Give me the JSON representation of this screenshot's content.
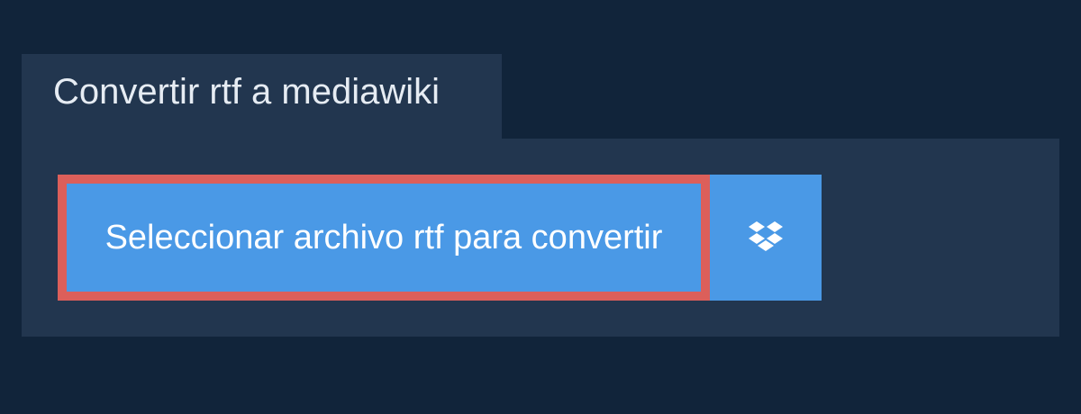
{
  "tab": {
    "title": "Convertir rtf a mediawiki"
  },
  "upload": {
    "select_label": "Seleccionar archivo rtf para convertir",
    "dropbox_icon": "dropbox-icon"
  },
  "colors": {
    "background": "#11243a",
    "panel": "#22364f",
    "button": "#4a99e6",
    "highlight_border": "#dc5f5a",
    "text": "#ffffff"
  }
}
